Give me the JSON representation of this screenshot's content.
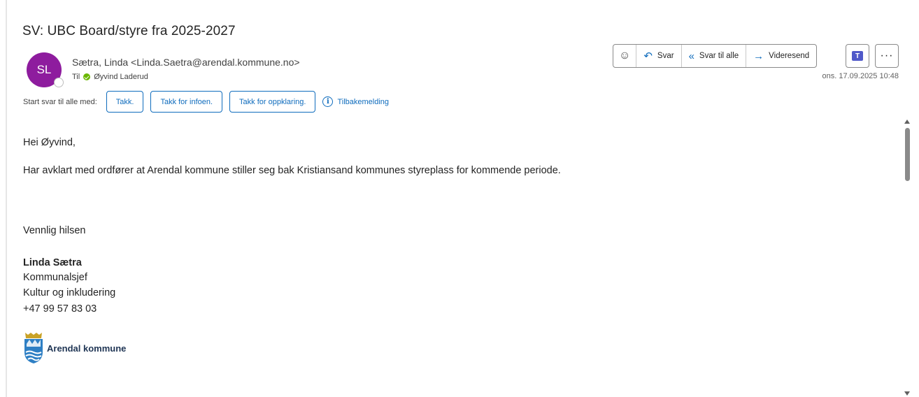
{
  "subject": "SV: UBC Board/styre fra 2025-2027",
  "sender": {
    "initials": "SL",
    "avatar_color": "#8e1c9e",
    "from": "Sætra, Linda <Linda.Saetra@arendal.kommune.no>",
    "to_label": "Til",
    "to_name": "Øyvind Laderud"
  },
  "actions": {
    "emoji_icon": "emoji-icon",
    "reply": "Svar",
    "reply_all": "Svar til alle",
    "forward": "Videresend",
    "teams_icon": "teams-icon",
    "more": "···"
  },
  "date": "ons. 17.09.2025 10:48",
  "quick_replies": {
    "label": "Start svar til alle med:",
    "chips": [
      "Takk.",
      "Takk for infoen.",
      "Takk for oppklaring."
    ],
    "feedback": "Tilbakemelding"
  },
  "body": {
    "greeting": "Hei Øyvind,",
    "paragraph": "Har avklart med ordfører at Arendal kommune stiller seg bak Kristiansand kommunes styreplass for kommende periode.",
    "closing": "Vennlig hilsen",
    "sig_name": "Linda Sætra",
    "sig_title": "Kommunalsjef",
    "sig_dept": "Kultur og inkludering",
    "sig_phone": "+47 99 57 83 03",
    "logo_text": "Arendal kommune"
  },
  "colors": {
    "accent": "#0f6cbd",
    "presence_available": "#6bb700"
  }
}
